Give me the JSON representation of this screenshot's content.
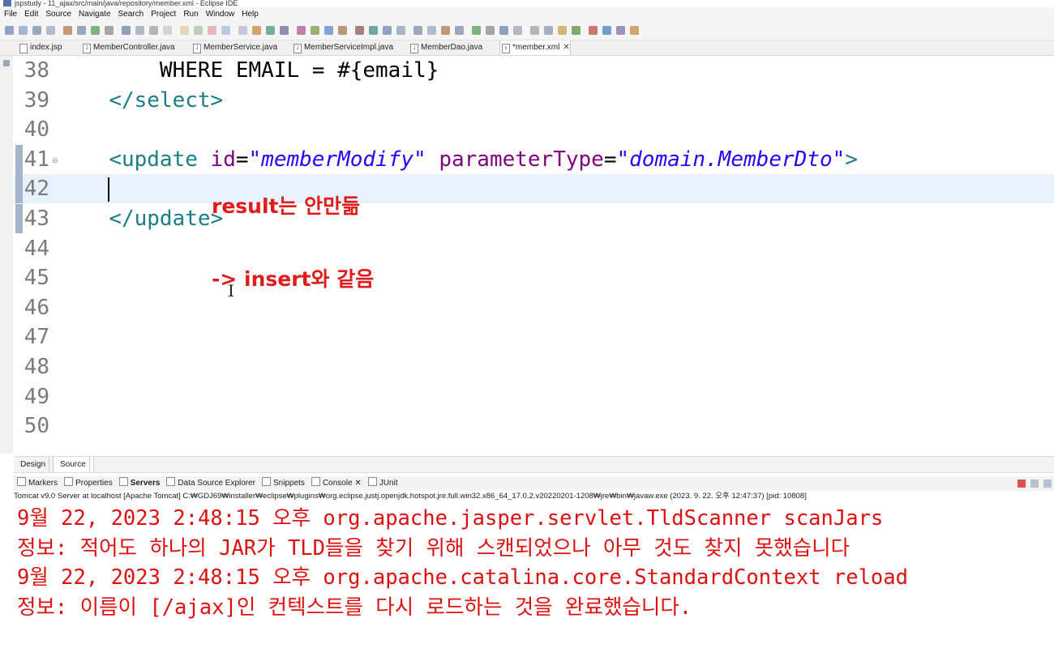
{
  "window": {
    "title": "jspstudy - 11_ajax/src/main/java/repository/member.xml - Eclipse IDE"
  },
  "menu": [
    "File",
    "Edit",
    "Source",
    "Navigate",
    "Search",
    "Project",
    "Run",
    "Window",
    "Help"
  ],
  "editor_tabs": [
    {
      "label": "index.jsp",
      "icon": "jsp-file-icon",
      "active": false
    },
    {
      "label": "MemberController.java",
      "icon": "java-file-icon",
      "active": false
    },
    {
      "label": "MemberService.java",
      "icon": "java-file-icon",
      "active": false
    },
    {
      "label": "MemberServiceImpl.java",
      "icon": "java-file-icon",
      "active": false
    },
    {
      "label": "MemberDao.java",
      "icon": "java-file-icon",
      "active": false
    },
    {
      "label": "*member.xml",
      "icon": "xml-file-icon",
      "active": true
    }
  ],
  "editor": {
    "lines": [
      {
        "num": "38",
        "parts": [
          {
            "t": "      WHERE EMAIL = #{email}",
            "c": ""
          }
        ]
      },
      {
        "num": "39",
        "parts": [
          {
            "t": "  ",
            "c": ""
          },
          {
            "t": "</select>",
            "c": "tag"
          }
        ]
      },
      {
        "num": "40",
        "parts": []
      },
      {
        "num": "41",
        "parts": [
          {
            "t": "  ",
            "c": ""
          },
          {
            "t": "<update ",
            "c": "tag"
          },
          {
            "t": "id",
            "c": "attr"
          },
          {
            "t": "=",
            "c": ""
          },
          {
            "t": "\"memberModify\"",
            "c": "val"
          },
          {
            "t": " parameterType",
            "c": "attr"
          },
          {
            "t": "=",
            "c": ""
          },
          {
            "t": "\"domain.MemberDto\"",
            "c": "val"
          },
          {
            "t": ">",
            "c": "tag"
          }
        ]
      },
      {
        "num": "42",
        "parts": []
      },
      {
        "num": "43",
        "parts": [
          {
            "t": "  ",
            "c": ""
          },
          {
            "t": "</update>",
            "c": "tag"
          }
        ]
      },
      {
        "num": "44",
        "parts": []
      },
      {
        "num": "45",
        "parts": []
      },
      {
        "num": "46",
        "parts": []
      },
      {
        "num": "47",
        "parts": []
      },
      {
        "num": "48",
        "parts": []
      },
      {
        "num": "49",
        "parts": []
      },
      {
        "num": "50",
        "parts": []
      }
    ],
    "current_line": "42",
    "changed_lines": [
      "41",
      "42",
      "43"
    ]
  },
  "annotations": {
    "note1": "result는 안만듦",
    "note2": "-> insert와 같음"
  },
  "editor_bottom_tabs": [
    "Design",
    "Source"
  ],
  "views": {
    "tabs": [
      {
        "label": "Markers",
        "active": false
      },
      {
        "label": "Properties",
        "active": false
      },
      {
        "label": "Servers",
        "active": true
      },
      {
        "label": "Data Source Explorer",
        "active": false
      },
      {
        "label": "Snippets",
        "active": false
      },
      {
        "label": "Console",
        "active": false,
        "closable": true
      },
      {
        "label": "JUnit",
        "active": false
      }
    ]
  },
  "console": {
    "title": "Tomcat v9.0 Server at localhost [Apache Tomcat] C:₩GDJ69₩installer₩eclipse₩plugins₩org.eclipse.justj.openjdk.hotspot.jre.full.win32.x86_64_17.0.2.v20220201-1208₩jre₩bin₩javaw.exe  (2023. 9. 22. 오후 12:47:37) [pid: 10808]",
    "lines": [
      "9월 22, 2023 2:48:15 오후 org.apache.jasper.servlet.TldScanner scanJars",
      "정보: 적어도 하나의 JAR가 TLD들을 찾기 위해 스캔되었으나 아무 것도 찾지 못했습니다",
      "9월 22, 2023 2:48:15 오후 org.apache.catalina.core.StandardContext reload",
      "정보: 이름이 [/ajax]인 컨텍스트를 다시 로드하는 것을 완료했습니다."
    ]
  },
  "colors": {
    "annotation": "#e01b1b",
    "console_text": "#dd1111",
    "xml_tag": "#1b7d86",
    "xml_attr": "#7f007f",
    "xml_value": "#2a00ff",
    "current_line_bg": "#e8f2fe"
  }
}
